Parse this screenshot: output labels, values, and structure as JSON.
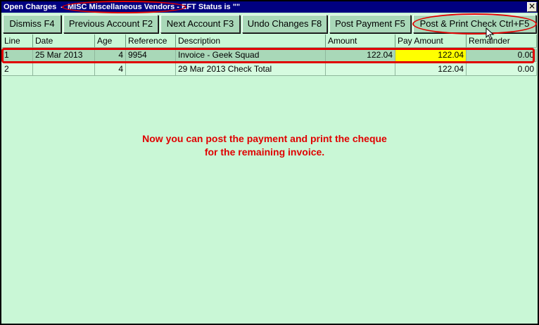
{
  "window": {
    "title_prefix": "Open Charges",
    "title_sep": "-",
    "vendor": "MISC Miscellaneous Vendors",
    "title_suffix": "- EFT Status is \"\"",
    "close_glyph": "✕"
  },
  "toolbar": {
    "dismiss": "Dismiss F4",
    "previous": "Previous Account F2",
    "next": "Next Account F3",
    "undo": "Undo Changes F8",
    "post": "Post Payment F5",
    "post_print": "Post & Print Check Ctrl+F5"
  },
  "table": {
    "columns": [
      "Line",
      "Date",
      "Age",
      "Reference",
      "Description",
      "Amount",
      "Pay Amount",
      "Remainder"
    ],
    "rows": [
      {
        "line": "1",
        "date": "25 Mar 2013",
        "age": "4",
        "reference": "9954",
        "description": "Invoice - Geek Squad",
        "amount": "122.04",
        "pay_amount": "122.04",
        "remainder": "0.00"
      },
      {
        "line": "2",
        "date": "",
        "age": "4",
        "reference": "",
        "description": "29 Mar 2013 Check Total",
        "amount": "",
        "pay_amount": "122.04",
        "remainder": "0.00"
      }
    ]
  },
  "note": {
    "line1": "Now you can post the payment and print the cheque",
    "line2": "for the remaining invoice."
  },
  "colors": {
    "annotation": "#e00000",
    "highlight": "#ffff00",
    "background": "#c9f7d6",
    "titlebar": "#000080"
  }
}
